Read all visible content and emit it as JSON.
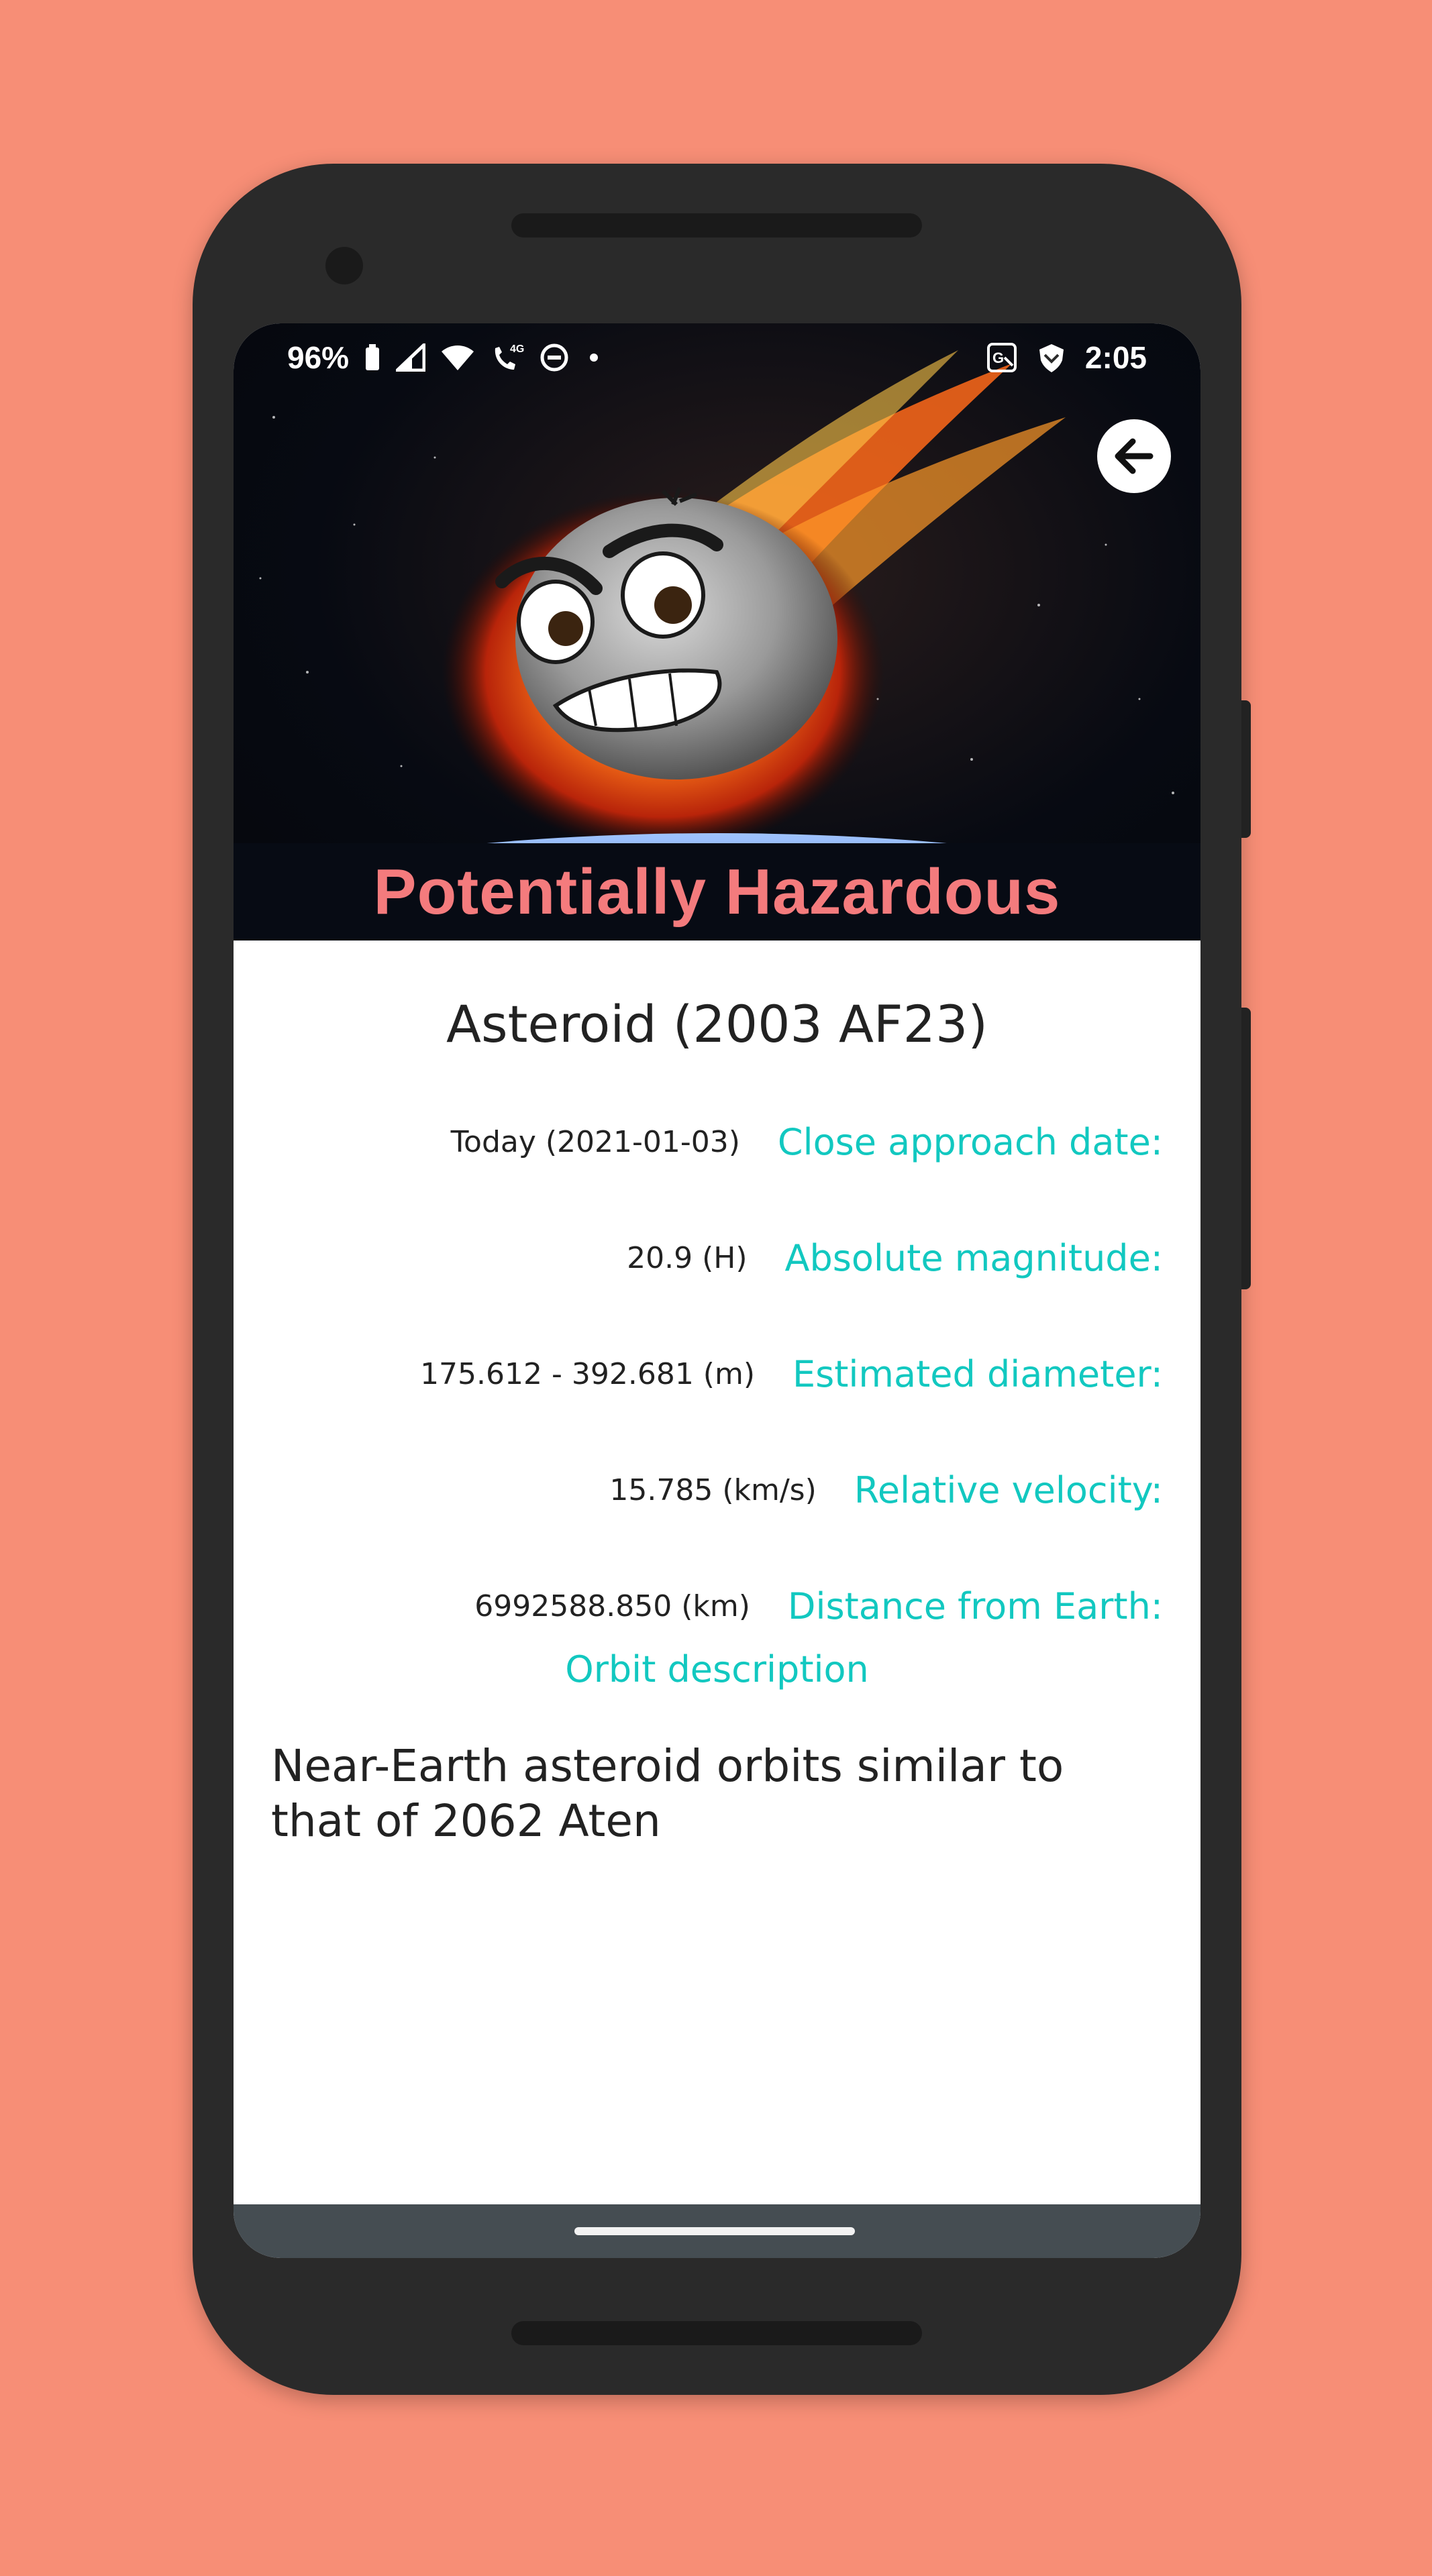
{
  "status_bar": {
    "battery": "96%",
    "time": "2:05",
    "network_label": "4G",
    "icons": [
      "battery-icon",
      "signal-icon",
      "wifi-icon",
      "call-4g-icon",
      "dnd-icon",
      "dot-icon",
      "translate-icon",
      "shield-icon"
    ]
  },
  "hero": {
    "banner": "Potentially Hazardous",
    "back_icon": "arrow-left-icon"
  },
  "asteroid": {
    "title": "Asteroid (2003 AF23)",
    "details": [
      {
        "label": "Close approach date:",
        "value": "Today (2021-01-03)"
      },
      {
        "label": "Absolute magnitude:",
        "value": "20.9 (H)"
      },
      {
        "label": "Estimated diameter:",
        "value": "175.612 - 392.681 (m)"
      },
      {
        "label": "Relative velocity:",
        "value": "15.785 (km/s)"
      },
      {
        "label": "Distance from Earth:",
        "value": "6992588.850 (km)"
      }
    ],
    "orbit_heading": "Orbit description",
    "orbit_description": "Near-Earth asteroid orbits similar to that of 2062 Aten"
  },
  "colors": {
    "background": "#F78E76",
    "accent": "#12C8C0",
    "banner_text": "#F47B7D"
  }
}
